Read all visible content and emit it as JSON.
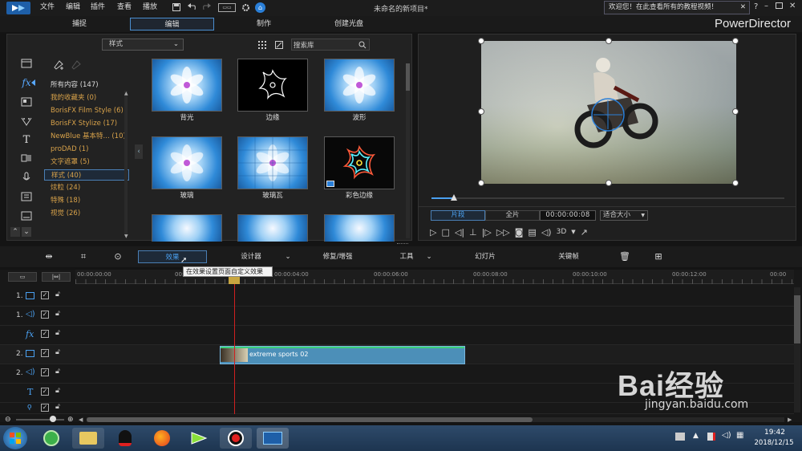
{
  "menu": [
    "文件",
    "编辑",
    "插件",
    "查看",
    "播放"
  ],
  "window_title": "未命名的新项目*",
  "welcome": "欢迎您！在此查看所有的教程视频！",
  "brand": "PowerDirector",
  "mode_tabs": [
    "捕捉",
    "编辑",
    "制作",
    "创建光盘"
  ],
  "library": {
    "dropdown": "样式",
    "search_placeholder": "搜索库",
    "categories": [
      "所有内容 (147)",
      "我的收藏夹 (0)",
      "BorisFX Film Style (6)",
      "BorisFX Stylize (17)",
      "NewBlue 基本特... (10)",
      "proDAD (1)",
      "文字遮罩 (5)",
      "样式 (40)",
      "炫粒 (24)",
      "特殊 (18)",
      "视觉 (26)"
    ],
    "effects": [
      "背光",
      "边缘",
      "波形",
      "玻璃",
      "玻璃瓦",
      "彩色边缘"
    ]
  },
  "preview": {
    "segment": "片段",
    "full": "全片",
    "timecode": "00:00:00:08",
    "fit": "适合大小",
    "d3": "3D"
  },
  "tools": {
    "effects": "效果",
    "designer": "设计器",
    "fix": "修复/增强",
    "tools": "工具",
    "slideshow": "幻灯片",
    "keyframe": "关键帧",
    "tooltip": "在效果设置页面自定义效果"
  },
  "timeline": {
    "ruler": [
      "00:00:00:00",
      "00:00:02:00",
      "00:00:04:00",
      "00:00:06:00",
      "00:00:08:00",
      "00:00:10:00",
      "00:00:12:00",
      "00:00"
    ],
    "tracks": [
      "1.",
      "1.",
      "fx",
      "2.",
      "2.",
      "T",
      ""
    ],
    "clip": "extreme sports 02"
  },
  "clock": {
    "time": "19:42",
    "date": "2018/12/15"
  },
  "watermark": {
    "text": "Bai经验",
    "url": "jingyan.baidu.com"
  }
}
